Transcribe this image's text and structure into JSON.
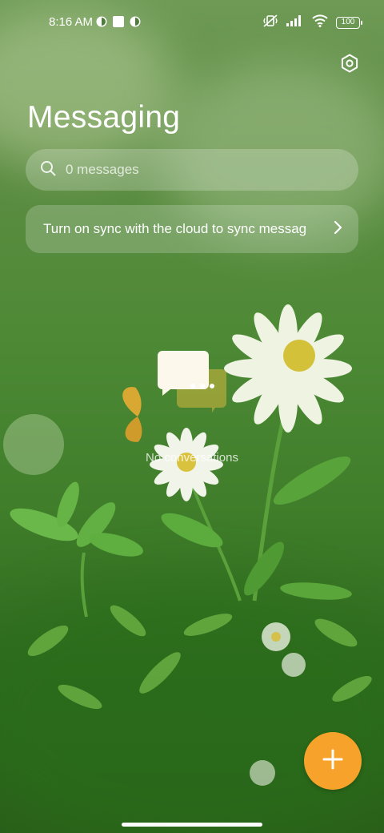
{
  "status_bar": {
    "time": "8:16 AM",
    "battery": "100",
    "icons": [
      "vpn-icon",
      "square-notification-icon",
      "vpn-icon",
      "vibrate-off-icon",
      "signal-icon",
      "wifi-icon",
      "battery-icon"
    ]
  },
  "header": {
    "title": "Messaging",
    "settings_icon": "settings-icon"
  },
  "search": {
    "placeholder": "0 messages",
    "value": ""
  },
  "sync_banner": {
    "text": "Turn on sync with the cloud to sync messages"
  },
  "empty_state": {
    "label": "No conversations",
    "icon": "chat-bubbles-icon"
  },
  "fab": {
    "icon": "plus-icon",
    "color": "#f7a22b"
  },
  "colors": {
    "accent": "#f7a22b",
    "background": "#4e8a36"
  }
}
